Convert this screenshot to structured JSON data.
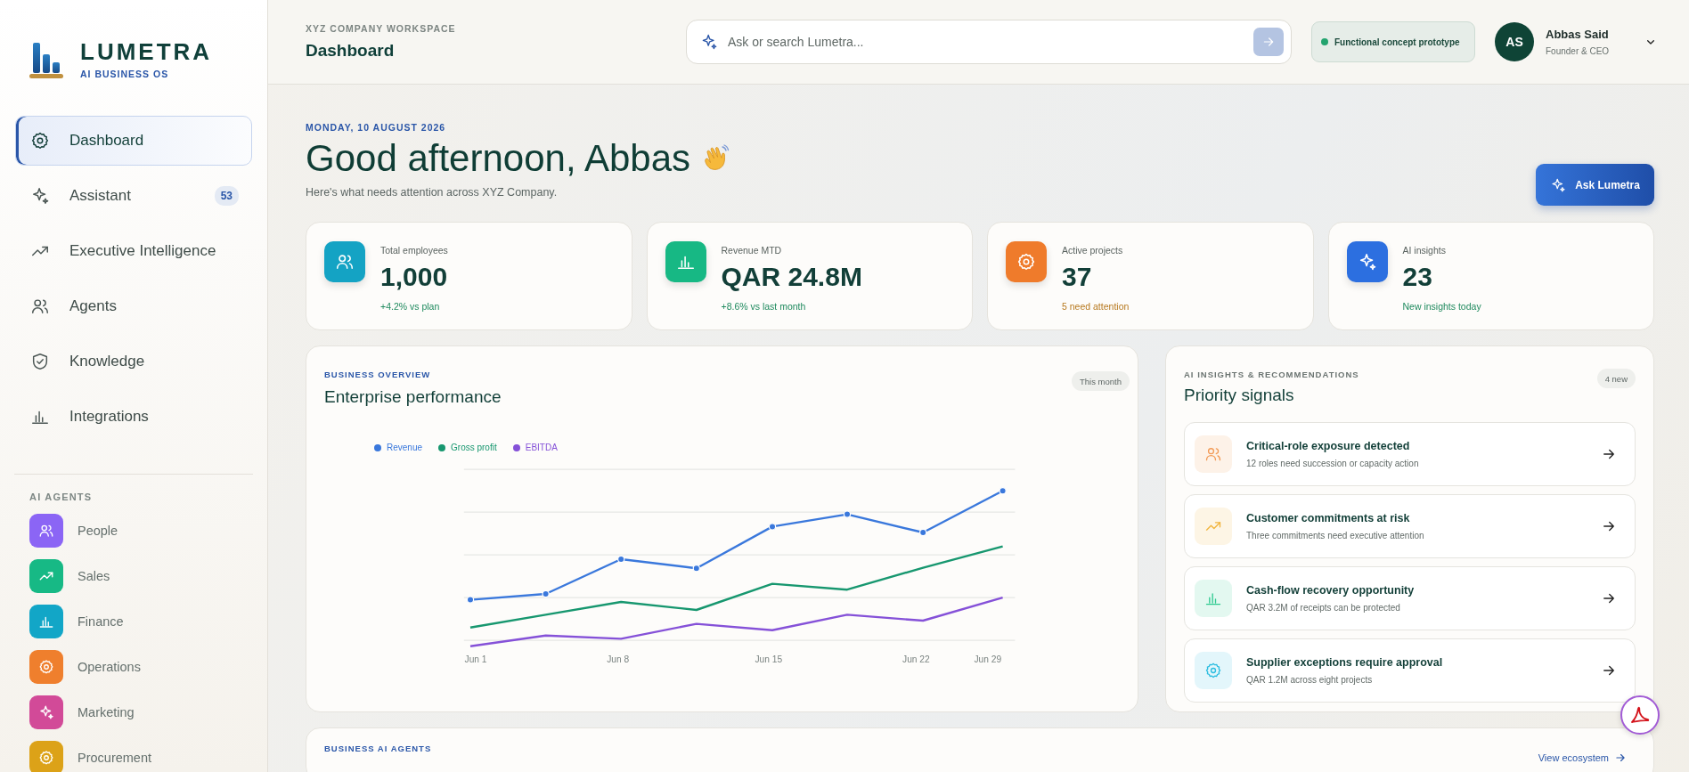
{
  "brand": {
    "name": "LUMETRA",
    "tagline": "AI BUSINESS OS"
  },
  "nav": [
    {
      "label": "Dashboard",
      "selected": true
    },
    {
      "label": "Assistant",
      "selected": false,
      "badge": "53"
    },
    {
      "label": "Executive Intelligence",
      "selected": false
    },
    {
      "label": "Agents",
      "selected": false
    },
    {
      "label": "Knowledge",
      "selected": false
    },
    {
      "label": "Integrations",
      "selected": false
    }
  ],
  "ai_agents": {
    "title": "AI AGENTS",
    "items": [
      {
        "label": "People",
        "color": "#8b65f5"
      },
      {
        "label": "Sales",
        "color": "#17b985"
      },
      {
        "label": "Finance",
        "color": "#12a6c7"
      },
      {
        "label": "Operations",
        "color": "#ef7f2d"
      },
      {
        "label": "Marketing",
        "color": "#d24a98"
      },
      {
        "label": "Procurement",
        "color": "#dca218"
      }
    ]
  },
  "header": {
    "workspace": "XYZ COMPANY WORKSPACE",
    "title": "Dashboard",
    "search": {
      "placeholder": "Ask or search Lumetra..."
    },
    "status": "Functional concept prototype",
    "user": {
      "initials": "AS",
      "name": "Abbas Said",
      "role": "Founder & CEO"
    }
  },
  "greeting": {
    "date": "MONDAY, 10 AUGUST 2026",
    "title": "Good afternoon, Abbas",
    "subtitle": "Here's what needs attention across XYZ Company.",
    "action": "Ask Lumetra"
  },
  "stats": [
    {
      "label": "Total employees",
      "value": "1,000",
      "note": "+4.2% vs plan",
      "attention": false,
      "color": "#14a3c4"
    },
    {
      "label": "Revenue MTD",
      "value": "QAR 24.8M",
      "note": "+8.6% vs last month",
      "attention": false,
      "color": "#17b884"
    },
    {
      "label": "Active projects",
      "value": "37",
      "note": "5 need attention",
      "attention": true,
      "color": "#ef7b2b"
    },
    {
      "label": "AI insights",
      "value": "23",
      "note": "New insights today",
      "attention": false,
      "color": "#2c6fe0"
    }
  ],
  "performance": {
    "eyebrow": "BUSINESS OVERVIEW",
    "title": "Enterprise performance",
    "period": "This month",
    "legend": [
      {
        "label": "Revenue",
        "color": "#3a78dc"
      },
      {
        "label": "Gross profit",
        "color": "#17976f"
      },
      {
        "label": "EBITDA",
        "color": "#8551d8"
      }
    ],
    "x_labels": [
      "Jun 1",
      "Jun 8",
      "Jun 15",
      "Jun 22",
      "Jun 29"
    ]
  },
  "signals": {
    "eyebrow": "AI INSIGHTS & RECOMMENDATIONS",
    "title": "Priority signals",
    "count": "4 new",
    "items": [
      {
        "title": "Critical-role exposure detected",
        "detail": "12 roles need succession or capacity action",
        "color": "#f29a55"
      },
      {
        "title": "Customer commitments at risk",
        "detail": "Three commitments need executive attention",
        "color": "#f1b43c"
      },
      {
        "title": "Cash-flow recovery opportunity",
        "detail": "QAR 3.2M of receipts can be protected",
        "color": "#2cc98f"
      },
      {
        "title": "Supplier exceptions require approval",
        "detail": "QAR 1.2M across eight projects",
        "color": "#2bbde0"
      }
    ]
  },
  "business_agents": {
    "eyebrow": "BUSINESS AI AGENTS",
    "link": "View ecosystem"
  }
}
